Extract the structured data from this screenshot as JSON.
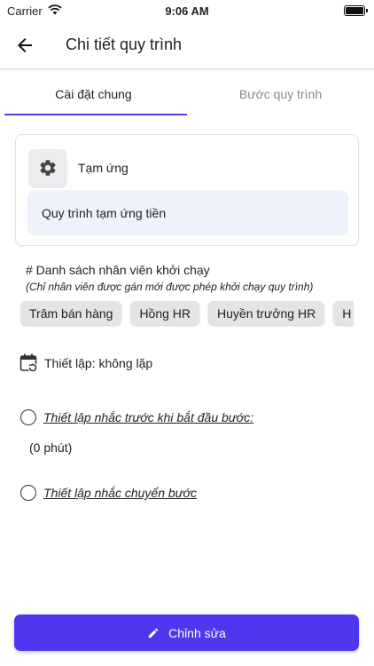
{
  "status_bar": {
    "carrier": "Carrier",
    "time": "9:06 AM"
  },
  "header": {
    "title": "Chi tiết quy trình"
  },
  "tabs": [
    {
      "label": "Cài đặt chung",
      "active": true
    },
    {
      "label": "Bước quy trình",
      "active": false
    }
  ],
  "process": {
    "name": "Tạm ứng",
    "description": "Quy trình tạm ứng tiền"
  },
  "launchers": {
    "heading": "# Danh sách nhân viên khởi chạy",
    "note": "(Chỉ nhân viên được gán mới được phép khởi chạy quy trình)",
    "chips": [
      "Trâm bán hàng",
      "Hồng HR",
      "Huyền trưởng HR",
      "H"
    ]
  },
  "repeat": {
    "label": "Thiết lập: không lặp"
  },
  "reminder_before_step": {
    "label": "Thiết lập nhắc trước khi bắt đầu bước:",
    "value": "(0 phút)"
  },
  "reminder_move_step": {
    "label": "Thiết lập nhắc chuyển bước"
  },
  "actions": {
    "edit_label": "Chỉnh sửa"
  },
  "colors": {
    "accent": "#4f36ef",
    "tab_indicator": "#5b3fe8",
    "desc_bg": "#eef2fb",
    "chip_bg": "#e4e4e6"
  }
}
